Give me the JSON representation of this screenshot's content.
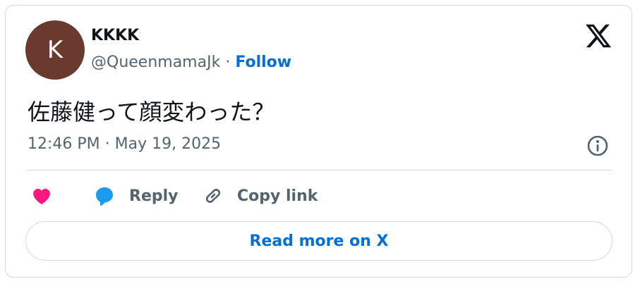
{
  "author": {
    "avatar_initial": "K",
    "avatar_color": "#6b3a2e",
    "display_name": "KKKK",
    "handle": "@QueenmamaJk",
    "separator": " · ",
    "follow_label": "Follow"
  },
  "tweet": {
    "text": "佐藤健って顔変わった？",
    "timestamp": "12:46 PM · May 19, 2025"
  },
  "actions": {
    "like_icon": "heart-icon",
    "reply_label": "Reply",
    "reply_icon": "speech-bubble-icon",
    "copy_link_label": "Copy link",
    "copy_link_icon": "link-icon"
  },
  "read_more_label": "Read more on X",
  "colors": {
    "link_blue": "#006fd6",
    "like_pink": "#f91880",
    "reply_blue": "#1d9bf0",
    "secondary_text": "#536471",
    "border": "#cfd9de"
  }
}
